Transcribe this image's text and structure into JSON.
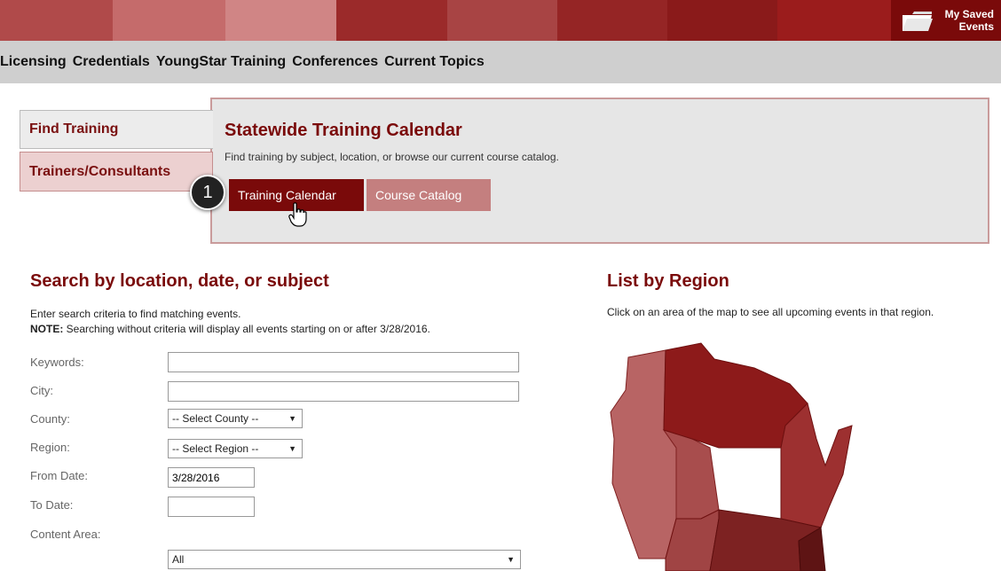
{
  "colors": {
    "band": [
      "#b04a4a",
      "#c56b6b",
      "#d08585",
      "#9b2a2a",
      "#b04a4a",
      "#9b2a2a",
      "#8a1a1a"
    ],
    "accent": "#7a0a0a",
    "accent_light": "#c47f7f"
  },
  "header": {
    "saved_events_line1": "My Saved",
    "saved_events_line2": "Events",
    "saved_events_icon": "folder-icon"
  },
  "nav": {
    "items": [
      "Licensing",
      "Credentials",
      "YoungStar Training",
      "Conferences",
      "Current Topics"
    ]
  },
  "side_tabs": {
    "find": "Find Training",
    "trainers": "Trainers/Consultants"
  },
  "panel": {
    "title": "Statewide Training Calendar",
    "subtitle": "Find training by subject, location, or browse our current course catalog.",
    "calendar_button": "Training Calendar",
    "catalog_button": "Course Catalog",
    "step_number": "1"
  },
  "search": {
    "title": "Search by location, date, or subject",
    "intro": "Enter search criteria to find matching events.",
    "note_label": "NOTE:",
    "note_text": " Searching without criteria will display all events starting on or after 3/28/2016.",
    "labels": {
      "keywords": "Keywords:",
      "city": "City:",
      "county": "County:",
      "region": "Region:",
      "from_date": "From Date:",
      "to_date": "To Date:",
      "content_area": "Content Area:"
    },
    "values": {
      "keywords": "",
      "city": "",
      "county": "-- Select County --",
      "region": "-- Select Region --",
      "from_date": "3/28/2016",
      "to_date": "",
      "content_area": "All"
    }
  },
  "region": {
    "title": "List by Region",
    "text": "Click on an area of the map to see all upcoming events in that region."
  }
}
